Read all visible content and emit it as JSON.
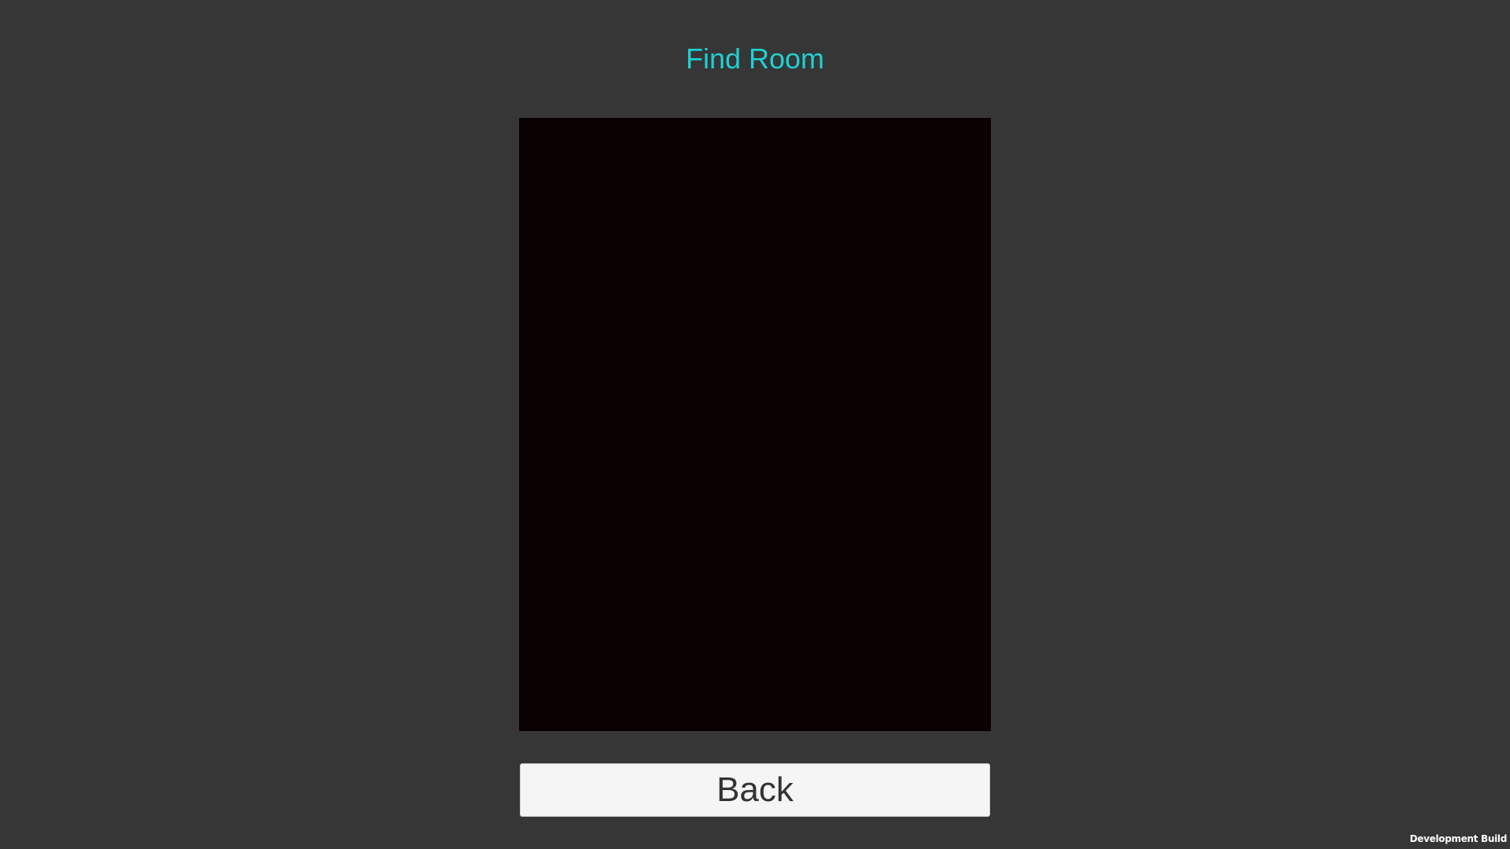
{
  "header": {
    "title": "Find Room"
  },
  "room_list": {
    "rooms": []
  },
  "footer": {
    "back_label": "Back"
  },
  "build_label": "Development Build",
  "colors": {
    "background": "#363636",
    "title": "#1fd0d2",
    "room_list_bg": "#0a0102",
    "button_bg": "#f5f5f5",
    "button_text": "#333333"
  }
}
